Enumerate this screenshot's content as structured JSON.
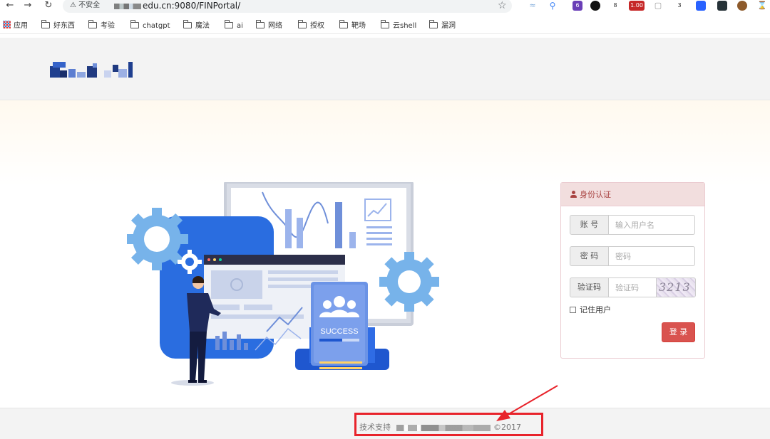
{
  "browser": {
    "security_label": "不安全",
    "url_text": "edu.cn:9080/FINPortal/",
    "bookmarks": [
      "应用",
      "好东西",
      "考验",
      "chatgpt",
      "魔法",
      "ai",
      "网络",
      "授权",
      "靶场",
      "云shell",
      "漏洞"
    ],
    "extensions": {
      "badge_1": "6",
      "badge_2": "8",
      "badge_3": "1.00",
      "badge_4": "3"
    }
  },
  "illustration": {
    "badge_text": "SUCCESS"
  },
  "login": {
    "title": "身份认证",
    "account_label": "账 号",
    "account_placeholder": "输入用户名",
    "password_label": "密 码",
    "password_placeholder": "密码",
    "captcha_label": "验证码",
    "captcha_placeholder": "验证码",
    "captcha_text": "3213",
    "remember_label": "记住用户",
    "submit_label": "登 录"
  },
  "footer": {
    "support_label": "技术支持",
    "year_text": "©2017"
  },
  "colors": {
    "panel_border": "#ebccd1",
    "panel_heading_bg": "#f2dede",
    "panel_heading_text": "#a94442",
    "login_button": "#d9534f",
    "annotation": "#e8232b"
  },
  "icons": [
    "back-arrow-icon",
    "forward-arrow-icon",
    "reload-icon",
    "warning-icon",
    "star-icon",
    "apps-grid-icon",
    "folder-icon",
    "user-icon",
    "gear-icon"
  ]
}
